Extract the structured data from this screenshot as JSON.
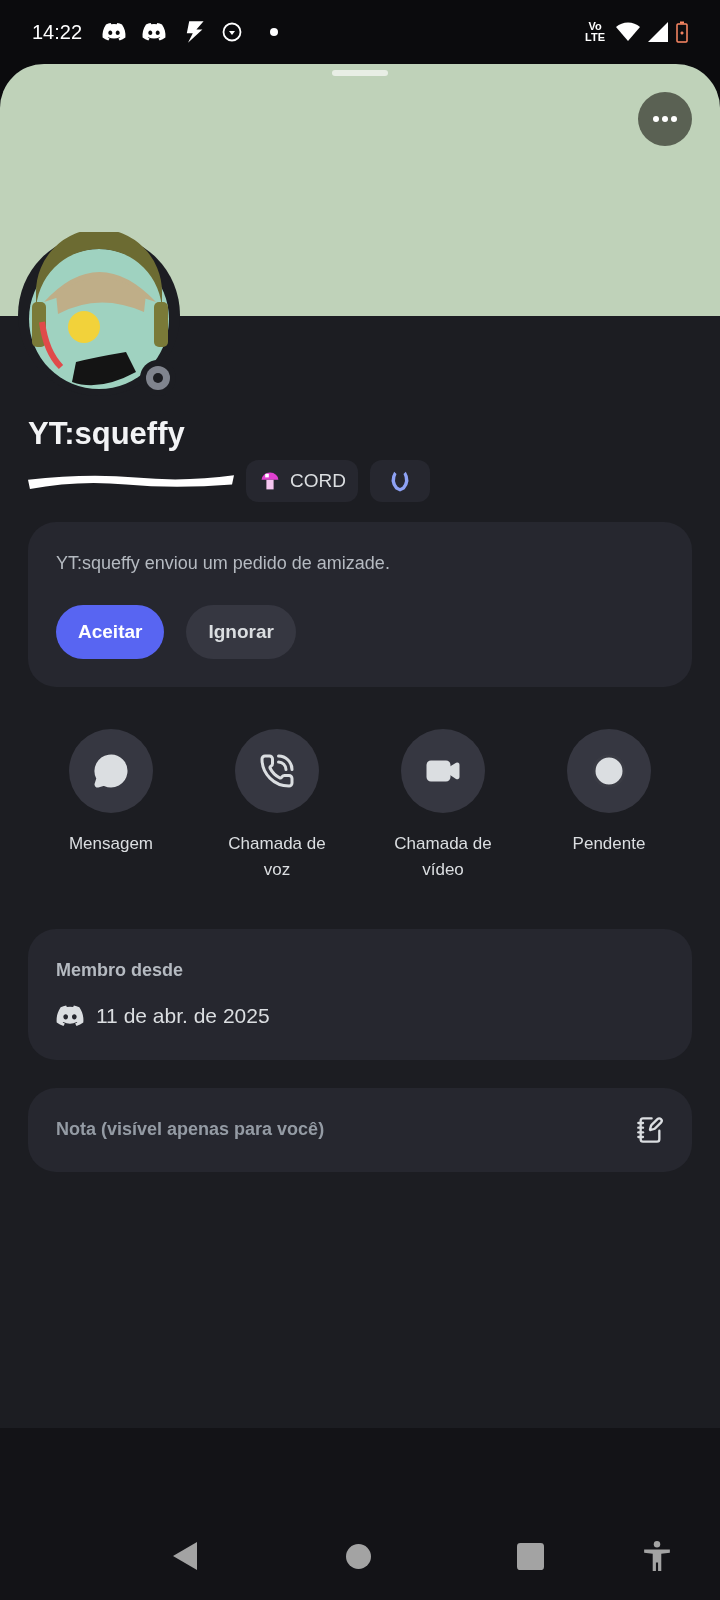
{
  "status_bar": {
    "time": "14:22",
    "network": "Vo LTE"
  },
  "profile": {
    "display_name": "YT:squeffy",
    "online": false,
    "badges": [
      {
        "kind": "tag",
        "label": "CORD"
      },
      {
        "kind": "icon"
      }
    ]
  },
  "friend_request": {
    "message": "YT:squeffy enviou um pedido de amizade.",
    "buttons": [
      {
        "label": "Aceitar",
        "kind": "primary"
      },
      {
        "label": "Ignorar",
        "kind": "secondary"
      }
    ]
  },
  "actions": [
    {
      "kind": "message",
      "label": "Mensagem"
    },
    {
      "kind": "voice",
      "label": "Chamada de voz"
    },
    {
      "kind": "video",
      "label": "Chamada de vídeo"
    },
    {
      "kind": "pending",
      "label": "Pendente"
    }
  ],
  "member_since": {
    "title": "Membro desde",
    "date": "11 de abr. de 2025"
  },
  "note": {
    "placeholder": "Nota (visível apenas para você)"
  }
}
